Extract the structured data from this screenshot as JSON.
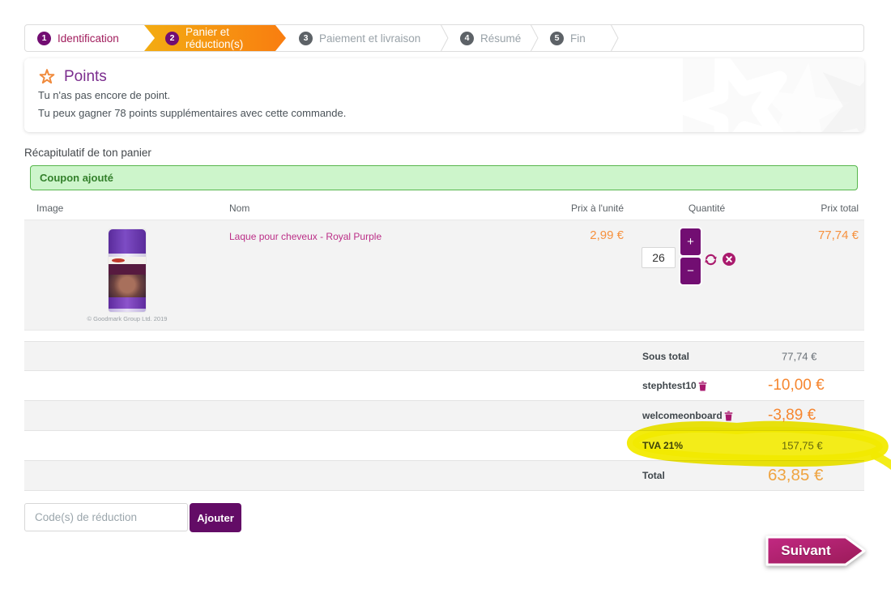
{
  "steps": [
    {
      "number": "1",
      "label": "Identification",
      "state": "done"
    },
    {
      "number": "2",
      "label": "Panier et réduction(s)",
      "state": "active"
    },
    {
      "number": "3",
      "label": "Paiement et livraison",
      "state": "todo"
    },
    {
      "number": "4",
      "label": "Résumé",
      "state": "todo"
    },
    {
      "number": "5",
      "label": "Fin",
      "state": "todo"
    }
  ],
  "points": {
    "title": "Points",
    "line1": "Tu n'as pas encore de point.",
    "line2": "Tu peux gagner 78 points supplémentaires avec cette commande."
  },
  "cart": {
    "heading": "Récapitulatif de ton panier",
    "coupon_banner": "Coupon ajouté",
    "columns": {
      "image": "Image",
      "name": "Nom",
      "unit_price": "Prix à l'unité",
      "quantity": "Quantité",
      "total": "Prix total"
    },
    "item": {
      "name": "Laque pour cheveux - Royal Purple",
      "unit_price": "2,99 €",
      "quantity": "26",
      "total": "77,74 €",
      "image_copyright": "© Goodmark Group Ltd. 2019",
      "plus_label": "+",
      "minus_label": "−"
    },
    "summary": [
      {
        "label": "Sous total",
        "value": "77,74 €"
      },
      {
        "label": "stephtest10",
        "value": "-10,00 €"
      },
      {
        "label": "welcomeonboard",
        "value": "-3,89 €"
      },
      {
        "label": "TVA 21%",
        "value": "157,75 €"
      },
      {
        "label": "Total",
        "value": "63,85 €"
      }
    ]
  },
  "coupon_form": {
    "placeholder": "Code(s) de réduction",
    "button": "Ajouter"
  },
  "next_button": {
    "label": "Suivant"
  },
  "colors": {
    "accent_purple": "#720d72",
    "button_purple": "#630c66",
    "magenta_icon": "#aa1a6d",
    "step_active_from": "#f3ac12",
    "step_active_to": "#f97d10",
    "price_orange": "#f6913e",
    "discount_orange": "#f6862f",
    "total_amber": "#efa441",
    "banner_green_bg": "#cdf5cb",
    "banner_green_border": "#57b64c",
    "banner_green_text": "#33802b",
    "highlight_yellow": "#f2ea00",
    "product_link_pink": "#bb2e87",
    "points_title_purple": "#7b2d8e",
    "star_orange": "#f08a3c"
  }
}
